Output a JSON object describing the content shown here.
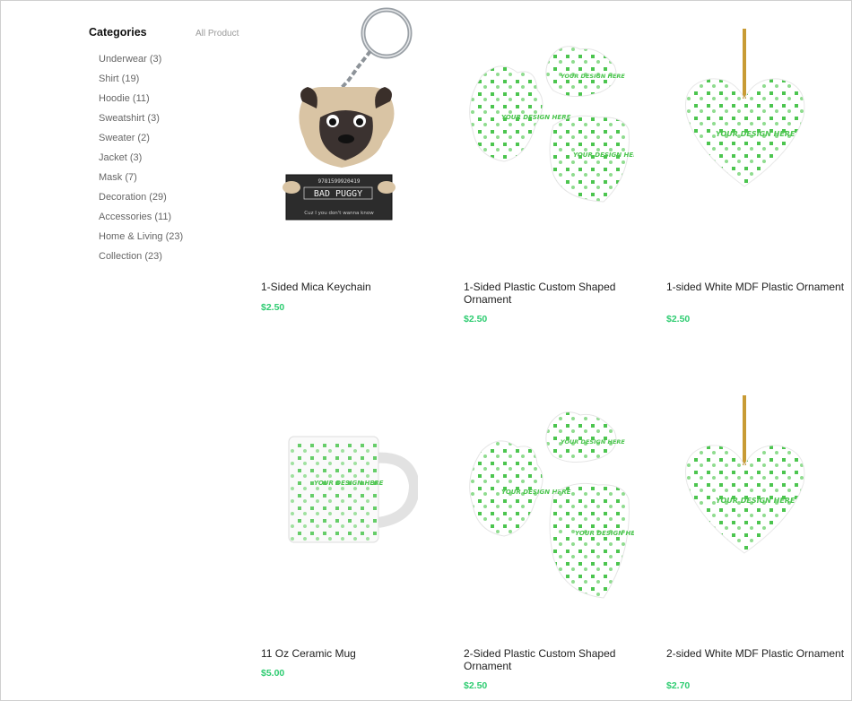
{
  "sidebar": {
    "title": "Categories",
    "all_link": "All Product",
    "items": [
      {
        "label": "Underwear (3)"
      },
      {
        "label": "Shirt (19)"
      },
      {
        "label": "Hoodie (11)"
      },
      {
        "label": "Sweatshirt (3)"
      },
      {
        "label": "Sweater (2)"
      },
      {
        "label": "Jacket (3)"
      },
      {
        "label": "Mask (7)"
      },
      {
        "label": "Decoration (29)"
      },
      {
        "label": "Accessories (11)"
      },
      {
        "label": "Home & Living (23)"
      },
      {
        "label": "Collection (23)"
      }
    ]
  },
  "products": [
    {
      "name": "1-Sided Mica Keychain",
      "price": "$2.50",
      "image": "pug-keychain-image",
      "keychain_text": {
        "headline": "BAD PUGGY",
        "mug_id": "9781599920419",
        "caption": "Cuz I you don't wanna know"
      }
    },
    {
      "name": "1-Sided Plastic Custom Shaped Ornament",
      "price": "$2.50",
      "image": "custom-shaped-ornaments-image",
      "pattern_text": "YOUR DESIGN HERE"
    },
    {
      "name": "1-sided White MDF Plastic Ornament",
      "price": "$2.50",
      "image": "heart-ornament-image",
      "pattern_text": "YOUR DESIGN HERE"
    },
    {
      "name": "11 Oz Ceramic Mug",
      "price": "$5.00",
      "image": "ceramic-mug-image",
      "pattern_text": "YOUR DESIGN HERE"
    },
    {
      "name": "2-Sided Plastic Custom Shaped Ornament",
      "price": "$2.50",
      "image": "custom-shaped-ornaments-image",
      "pattern_text": "YOUR DESIGN HERE"
    },
    {
      "name": "2-sided White MDF Plastic Ornament",
      "price": "$2.70",
      "image": "heart-ornament-image",
      "pattern_text": "YOUR DESIGN HERE"
    }
  ],
  "colors": {
    "price": "#2ecc71",
    "pattern": "#4cc54f",
    "pattern_light": "#8fdc8f"
  }
}
